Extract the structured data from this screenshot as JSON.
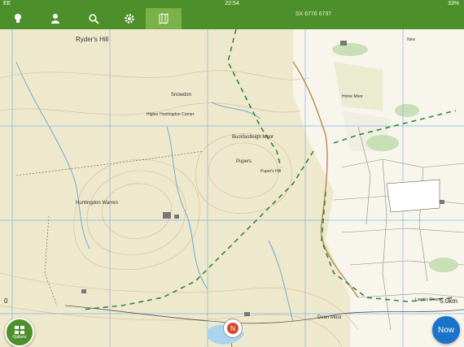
{
  "status_bar": {
    "carrier": "EE",
    "time": "22:54",
    "battery": "33%"
  },
  "toolbar": {
    "buttons": [
      {
        "name": "lightbulb-icon"
      },
      {
        "name": "user-icon"
      },
      {
        "name": "search-icon"
      },
      {
        "name": "gear-icon"
      },
      {
        "name": "map-icon",
        "active": true
      }
    ],
    "grid_ref": "SX 6776 6737"
  },
  "map": {
    "labels": {
      "ryders_hill": "Ryder's Hill",
      "snowdon": "Snowdon",
      "huntingdon_warren": "Huntingdon Warren",
      "buckfastleigh_moor": "Buckfastleigh Moor",
      "puper_hill": "Puper's Hill",
      "pupers": "Pupers",
      "higher_huntingdon_corner": "Higher Huntingdon Corner",
      "dean_moor": "Dean Moor",
      "new_town": "New",
      "holne_moor": "Holne Moor",
      "lambs_down": "Lamb's Down"
    },
    "scale_left": "0",
    "scale_right": "5.0km"
  },
  "controls": {
    "options_label": "Options",
    "now_label": "Now",
    "compass_label": "N"
  },
  "colors": {
    "brand_green": "#4d8f2a",
    "now_blue": "#1a73c9",
    "map_bg": "#eee8cc"
  }
}
